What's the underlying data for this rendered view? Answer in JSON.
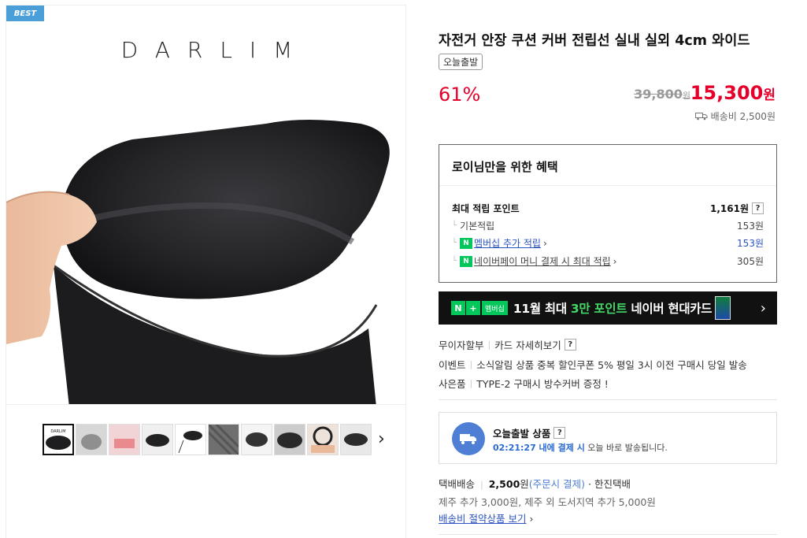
{
  "badge": "BEST",
  "brand": "DARLIM",
  "product": {
    "title": "자전거 안장 쿠션 커버 전립선 실내 실외 4cm 와이드",
    "tag": "오늘출발",
    "discount": "61%",
    "original_price": "39,800",
    "original_unit": "원",
    "sale_price": "15,300",
    "sale_unit": "원",
    "shipping_fee": "배송비 2,500원"
  },
  "benefits": {
    "title": "로이님만을 위한 혜택",
    "max_points_label": "최대 적립 포인트",
    "max_points_value": "1,161",
    "max_points_unit": "원",
    "help": "?",
    "basic_label": "기본적립",
    "basic_value": "153원",
    "membership_label": "멤버십 추가 적립",
    "membership_value": "153원",
    "npay_label": "네이버페이 머니 결제 시 최대 적립",
    "npay_value": "305원",
    "n_plus": "N +",
    "n_pay": "N"
  },
  "banner": {
    "n": "N",
    "plus": "+",
    "membership": "멤버십",
    "text_before": "11월 최대 ",
    "highlight": "3만 포인트",
    "text_after": " 네이버 현대카드"
  },
  "info": {
    "installment_label": "무이자할부",
    "installment_link": "카드 자세히보기",
    "event_label": "이벤트",
    "event_text": "소식알림 상품 중복 할인쿠폰 5% 평일 3시 이전 구매시 당일 발송",
    "gift_label": "사은품",
    "gift_text": "TYPE-2 구매시 방수커버 증정 !"
  },
  "today_shipping": {
    "title": "오늘출발 상품",
    "timer": "02:21:27 내에 결제 시",
    "sub": " 오늘 바로 발송됩니다."
  },
  "delivery": {
    "method": "택배배송",
    "fee": "2,500",
    "fee_unit": "원",
    "fee_note": "(주문시 결제)",
    "courier": "· 한진택배",
    "extra": "제주 추가 3,000원, 제주 외 도서지역 추가 5,000원",
    "save_link": "배송비 절약상품 보기"
  },
  "thumbnails": [
    "thumb-1",
    "thumb-2",
    "thumb-3",
    "thumb-4",
    "thumb-5",
    "thumb-6",
    "thumb-7",
    "thumb-8",
    "thumb-9",
    "thumb-10"
  ],
  "colors": {
    "accent_red": "#e4002b",
    "naver_green": "#03c75a",
    "link_blue": "#2a53c1"
  }
}
